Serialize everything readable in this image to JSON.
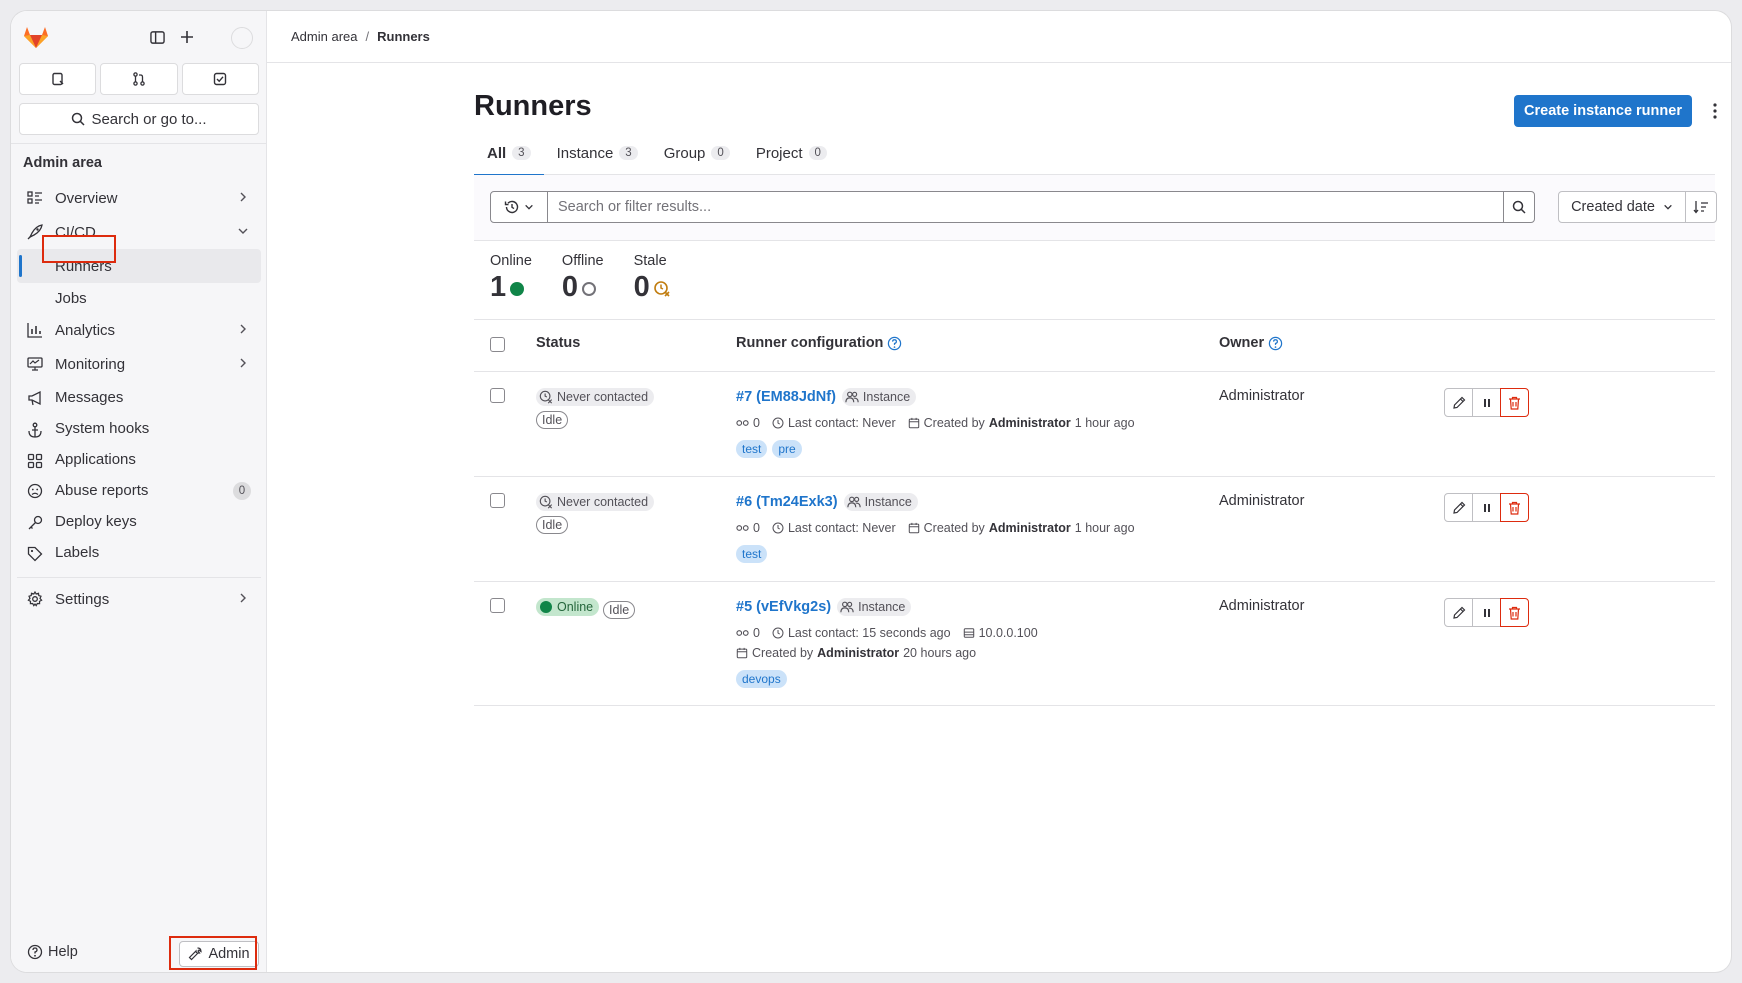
{
  "breadcrumb": {
    "parent": "Admin area",
    "separator": "/",
    "current": "Runners"
  },
  "sidebar": {
    "search_label": "Search or go to...",
    "heading": "Admin area",
    "items": [
      {
        "label": "Overview"
      },
      {
        "label": "CI/CD"
      },
      {
        "label": "Runners"
      },
      {
        "label": "Jobs"
      },
      {
        "label": "Analytics"
      },
      {
        "label": "Monitoring"
      },
      {
        "label": "Messages"
      },
      {
        "label": "System hooks"
      },
      {
        "label": "Applications"
      },
      {
        "label": "Abuse reports",
        "count": "0"
      },
      {
        "label": "Deploy keys"
      },
      {
        "label": "Labels"
      },
      {
        "label": "Settings"
      }
    ],
    "help_label": "Help",
    "admin_label": "Admin"
  },
  "page": {
    "title": "Runners",
    "create_button": "Create instance runner",
    "tabs": [
      {
        "label": "All",
        "count": "3"
      },
      {
        "label": "Instance",
        "count": "3"
      },
      {
        "label": "Group",
        "count": "0"
      },
      {
        "label": "Project",
        "count": "0"
      }
    ],
    "filter_placeholder": "Search or filter results...",
    "sort_label": "Created date",
    "stats": [
      {
        "label": "Online",
        "value": "1"
      },
      {
        "label": "Offline",
        "value": "0"
      },
      {
        "label": "Stale",
        "value": "0"
      }
    ],
    "columns": {
      "status": "Status",
      "config": "Runner configuration",
      "owner": "Owner"
    }
  },
  "runners": [
    {
      "status": "Never contacted",
      "state": "Idle",
      "name": "#7 (EM88JdNf)",
      "type": "Instance",
      "jobs": "0",
      "last_contact": "Last contact: Never",
      "created_prefix": "Created by",
      "created_by": "Administrator",
      "created_ago": "1 hour ago",
      "tags": [
        "test",
        "pre"
      ],
      "owner": "Administrator"
    },
    {
      "status": "Never contacted",
      "state": "Idle",
      "name": "#6 (Tm24Exk3)",
      "type": "Instance",
      "jobs": "0",
      "last_contact": "Last contact: Never",
      "created_prefix": "Created by",
      "created_by": "Administrator",
      "created_ago": "1 hour ago",
      "tags": [
        "test"
      ],
      "owner": "Administrator"
    },
    {
      "status": "Online",
      "state": "Idle",
      "name": "#5 (vEfVkg2s)",
      "type": "Instance",
      "jobs": "0",
      "last_contact": "Last contact: 15 seconds ago",
      "ip": "10.0.0.100",
      "created_prefix": "Created by",
      "created_by": "Administrator",
      "created_ago": "20 hours ago",
      "tags": [
        "devops"
      ],
      "owner": "Administrator"
    }
  ],
  "colors": {
    "accent": "#1f75cb",
    "online": "#108548",
    "danger": "#dd2b0e",
    "highlight": "#dd2b0e"
  }
}
